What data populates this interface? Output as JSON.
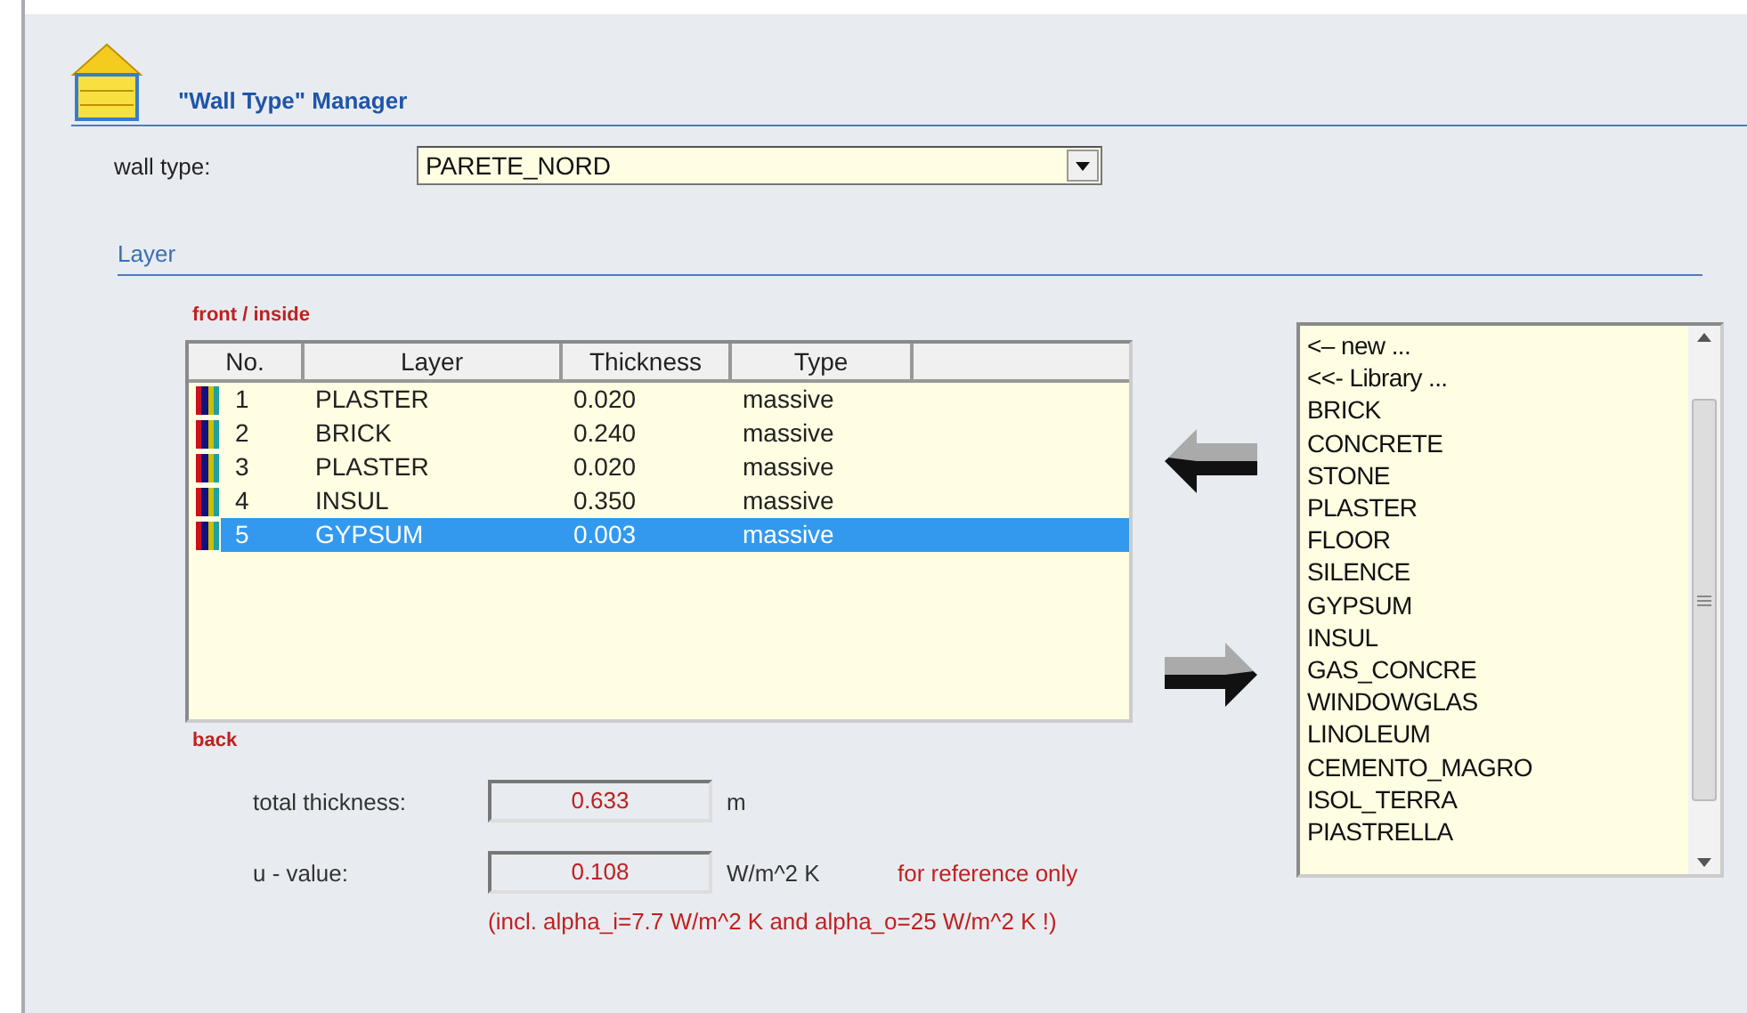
{
  "header": {
    "title": "\"Wall Type\" Manager"
  },
  "wall_type": {
    "label": "wall type:",
    "value": "PARETE_NORD"
  },
  "section": {
    "title": "Layer"
  },
  "front_label": "front / inside",
  "back_label": "back",
  "table": {
    "columns": [
      "No.",
      "Layer",
      "Thickness",
      "Type"
    ],
    "rows": [
      {
        "no": "1",
        "layer": "PLASTER",
        "thickness": "0.020",
        "type": "massive",
        "selected": false
      },
      {
        "no": "2",
        "layer": "BRICK",
        "thickness": "0.240",
        "type": "massive",
        "selected": false
      },
      {
        "no": "3",
        "layer": "PLASTER",
        "thickness": "0.020",
        "type": "massive",
        "selected": false
      },
      {
        "no": "4",
        "layer": "INSUL",
        "thickness": "0.350",
        "type": "massive",
        "selected": false
      },
      {
        "no": "5",
        "layer": "GYPSUM",
        "thickness": "0.003",
        "type": "massive",
        "selected": true
      }
    ]
  },
  "library": {
    "items": [
      "<– new ...",
      "<<- Library ...",
      "BRICK",
      "CONCRETE",
      "STONE",
      "PLASTER",
      "FLOOR",
      "SILENCE",
      "GYPSUM",
      "INSUL",
      "GAS_CONCRE",
      "WINDOWGLAS",
      "LINOLEUM",
      "CEMENTO_MAGRO",
      "ISOL_TERRA",
      "PIASTRELLA"
    ]
  },
  "results": [
    {
      "label": "total thickness:",
      "value": "0.633",
      "unit": "m"
    },
    {
      "label": "u - value:",
      "value": "0.108",
      "unit": "W/m^2 K",
      "note": "for reference only"
    }
  ],
  "footnote": "(incl. alpha_i=7.7 W/m^2 K and alpha_o=25 W/m^2 K !)"
}
